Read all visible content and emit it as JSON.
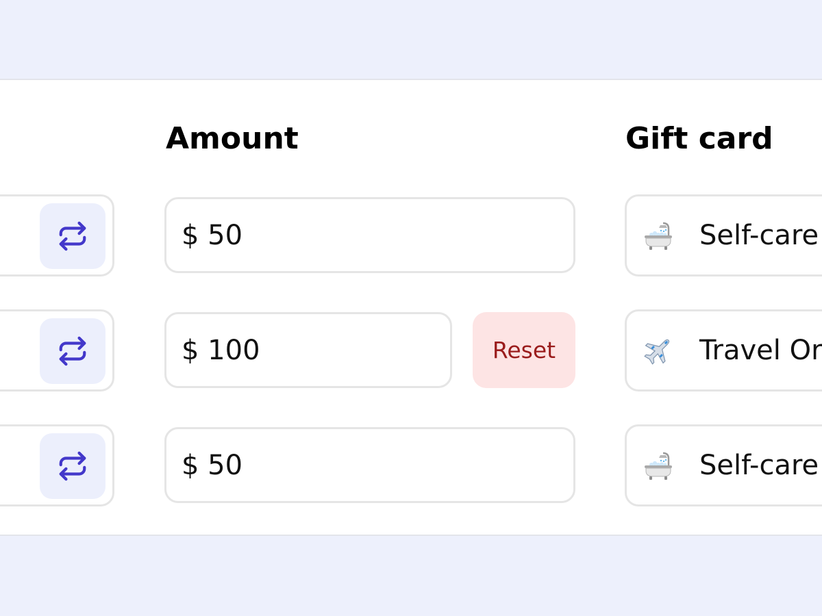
{
  "headers": {
    "amount": "Amount",
    "gift_card": "Gift card"
  },
  "rows": [
    {
      "amount_value": "$ 50",
      "gift_icon": "bathtub-icon",
      "gift_label": "Self-care"
    },
    {
      "amount_value": "$ 100",
      "reset_label": "Reset",
      "gift_icon": "airplane-icon",
      "gift_label": "Travel Or"
    },
    {
      "amount_value": "$ 50",
      "gift_icon": "bathtub-icon",
      "gift_label": "Self-care"
    }
  ],
  "colors": {
    "page_background": "#edf0fc",
    "accent": "#4338ca",
    "swap_button_bg": "#eceffc",
    "reset_bg": "#fde4e4",
    "reset_text": "#9a1c1c"
  }
}
